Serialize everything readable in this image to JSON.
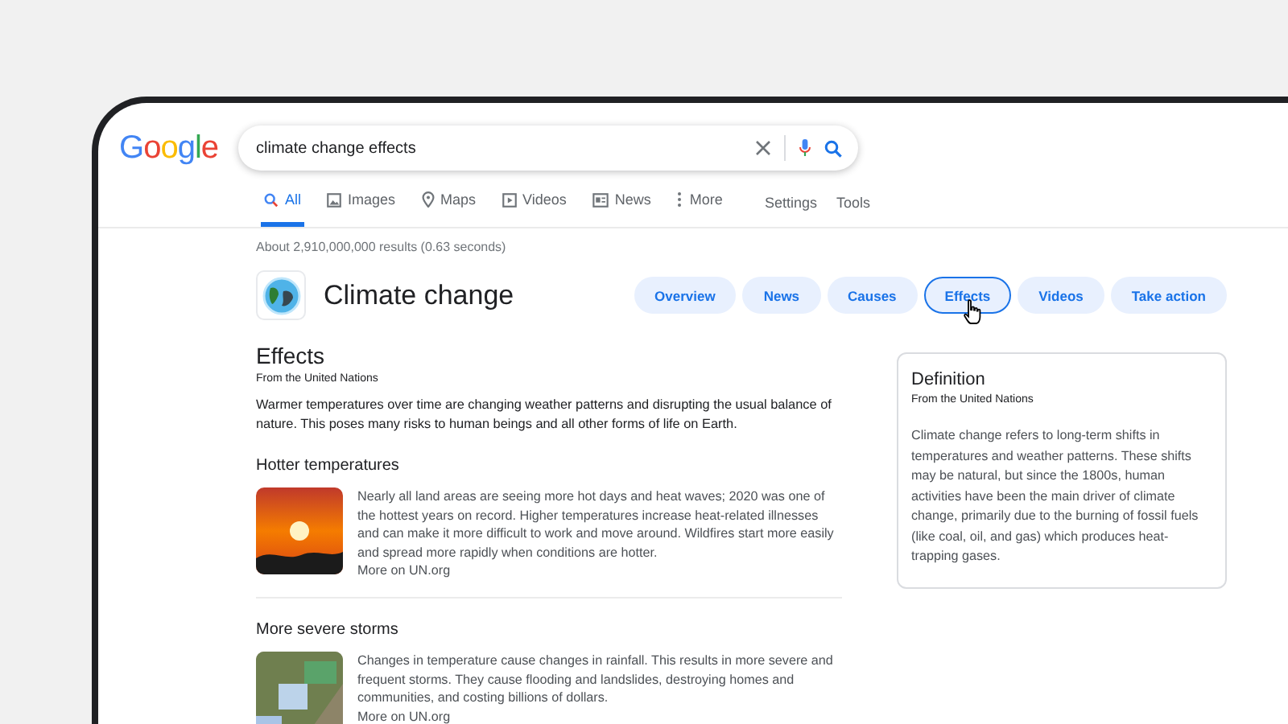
{
  "logo": "Google",
  "search": {
    "value": "climate change effects"
  },
  "tabs": [
    {
      "label": "All",
      "kind": "search",
      "selected": true
    },
    {
      "label": "Images",
      "kind": "image",
      "selected": false
    },
    {
      "label": "Maps",
      "kind": "pin",
      "selected": false
    },
    {
      "label": "Videos",
      "kind": "video",
      "selected": false
    },
    {
      "label": "News",
      "kind": "news",
      "selected": false
    },
    {
      "label": "More",
      "kind": "more",
      "selected": false
    }
  ],
  "tools": [
    "Settings",
    "Tools"
  ],
  "result_stats": "About 2,910,000,000 results (0.63 seconds)",
  "topic": {
    "title": "Climate change",
    "chips": [
      {
        "label": "Overview",
        "selected": false
      },
      {
        "label": "News",
        "selected": false
      },
      {
        "label": "Causes",
        "selected": false
      },
      {
        "label": "Effects",
        "selected": true
      },
      {
        "label": "Videos",
        "selected": false
      },
      {
        "label": "Take action",
        "selected": false
      }
    ]
  },
  "effects": {
    "title": "Effects",
    "source": "From the United Nations",
    "intro": "Warmer temperatures over time are changing weather patterns and disrupting the usual balance of nature. This poses many risks to human beings and all other forms of life on Earth.",
    "items": [
      {
        "heading": "Hotter temperatures",
        "kind": "sunset",
        "text": "Nearly all land areas are seeing more hot days and heat waves; 2020 was one of the hottest years on record. Higher temperatures increase heat-related illnesses and can make it more difficult to work and move around. Wildfires start more easily and spread more rapidly when conditions are hotter.",
        "link": "More on UN.org"
      },
      {
        "heading": "More severe storms",
        "kind": "houses",
        "text": "Changes in temperature cause changes in rainfall. This results in more severe and frequent storms. They cause flooding and landslides, destroying homes and communities, and costing billions of dollars.",
        "link": "More on UN.org"
      }
    ]
  },
  "definition": {
    "title": "Definition",
    "source": "From the United Nations",
    "text": "Climate change refers to long-term shifts in temperatures and weather patterns. These shifts may be natural, but since the 1800s, human activities have been the main driver of climate change, primarily due to the burning of fossil fuels (like coal, oil, and gas) which produces heat-trapping gases."
  }
}
